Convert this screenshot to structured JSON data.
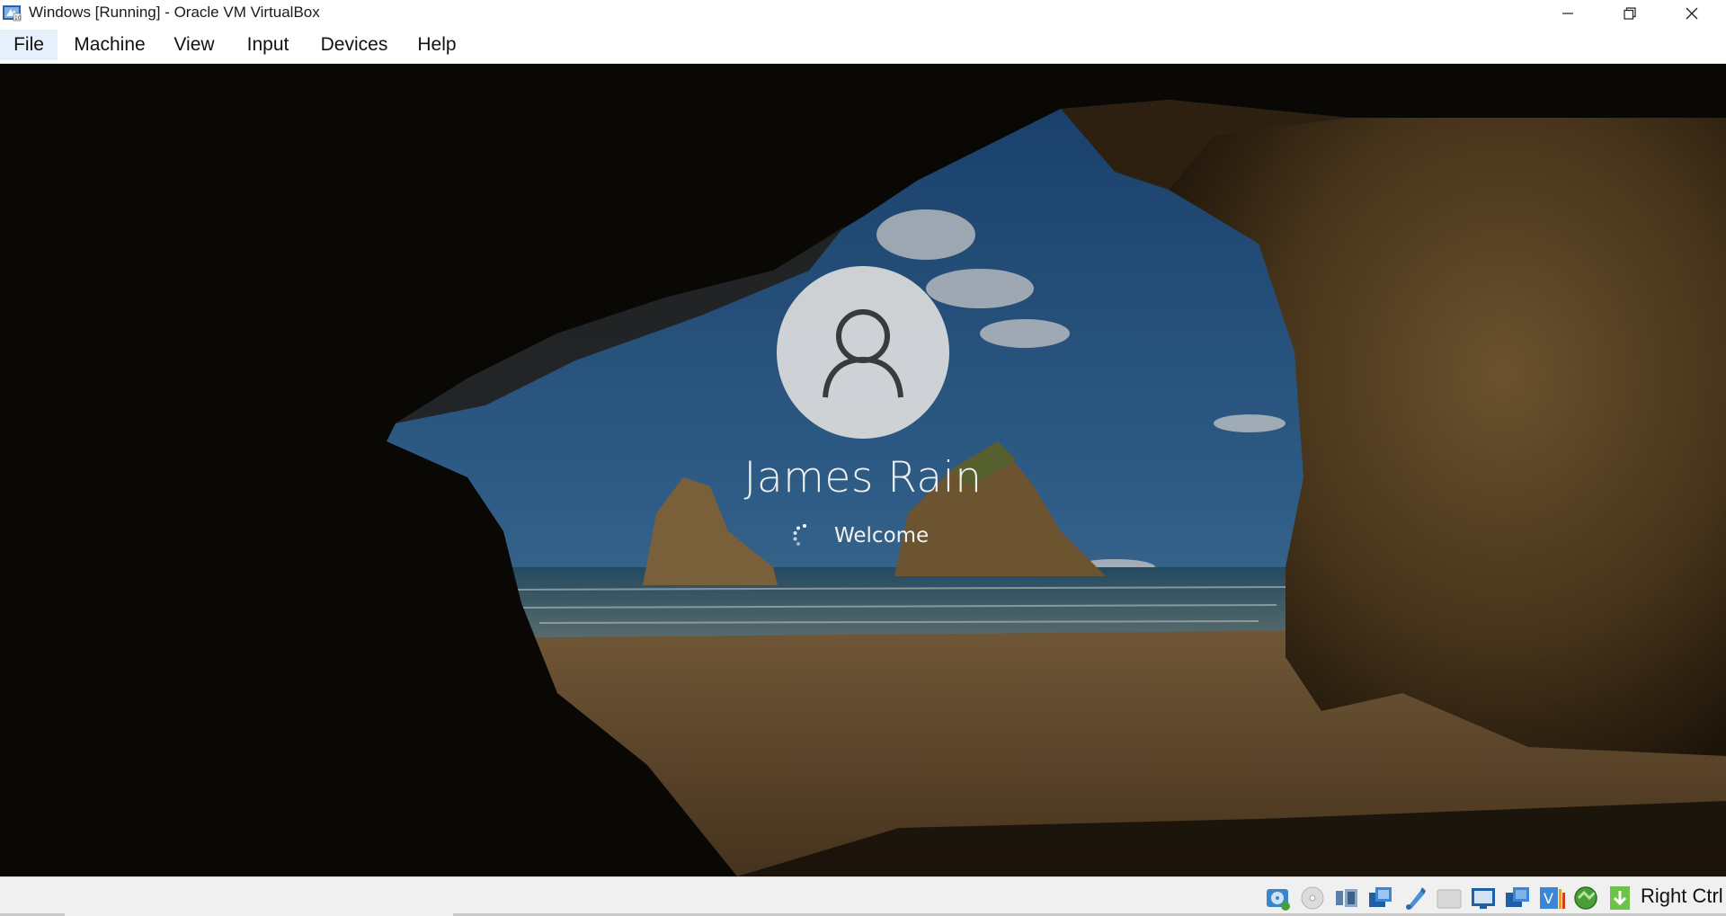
{
  "window": {
    "title": "Windows [Running] - Oracle VM VirtualBox",
    "controls": [
      "minimize",
      "restore",
      "close"
    ]
  },
  "menu": {
    "items": [
      {
        "label": "File",
        "active": true
      },
      {
        "label": "Machine",
        "active": false
      },
      {
        "label": "View",
        "active": false
      },
      {
        "label": "Input",
        "active": false
      },
      {
        "label": "Devices",
        "active": false
      },
      {
        "label": "Help",
        "active": false
      }
    ]
  },
  "login": {
    "user_name": "James Rain",
    "status": "Welcome",
    "avatar_icon": "user-silhouette-icon"
  },
  "statusbar": {
    "icons": [
      "hard-disk-icon",
      "optical-drive-icon",
      "audio-icon",
      "network-icon",
      "usb-icon",
      "shared-folders-icon",
      "display-icon",
      "recording-icon",
      "virtualization-icon",
      "cpu-activity-icon",
      "mouse-integration-icon",
      "keyboard-capture-icon"
    ],
    "host_key": "Right Ctrl"
  },
  "colors": {
    "menu_active_bg": "#e5f0fb",
    "statusbar_bg": "#f0f0f0",
    "avatar_bg": "#dcdcdc"
  }
}
